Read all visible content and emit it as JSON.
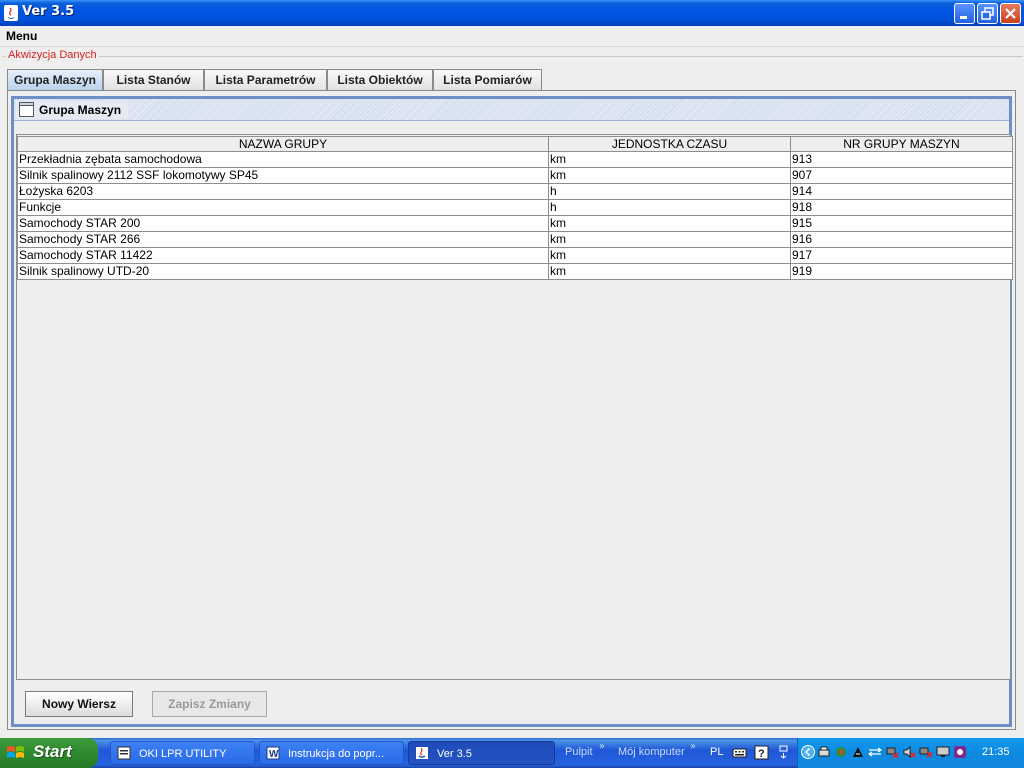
{
  "window": {
    "title": "Ver 3.5"
  },
  "menubar": {
    "menu_label": "Menu"
  },
  "group": {
    "legend": "Akwizycja Danych"
  },
  "tabs": [
    {
      "label": "Grupa Maszyn",
      "active": true
    },
    {
      "label": "Lista Stanów",
      "active": false
    },
    {
      "label": "Lista Parametrów",
      "active": false
    },
    {
      "label": "Lista Obiektów",
      "active": false
    },
    {
      "label": "Lista Pomiarów",
      "active": false
    }
  ],
  "panel": {
    "title": "Grupa Maszyn"
  },
  "table": {
    "columns": [
      "NAZWA GRUPY",
      "JEDNOSTKA CZASU",
      "NR GRUPY MASZYN"
    ],
    "rows": [
      [
        "Przekładnia zębata samochodowa",
        "km",
        "913"
      ],
      [
        "Silnik spalinowy 2112 SSF lokomotywy SP45",
        "km",
        "907"
      ],
      [
        "Łożyska 6203",
        "h",
        "914"
      ],
      [
        "Funkcje",
        "h",
        "918"
      ],
      [
        "Samochody STAR 200",
        "km",
        "915"
      ],
      [
        "Samochody STAR 266",
        "km",
        "916"
      ],
      [
        "Samochody STAR 11422",
        "km",
        "917"
      ],
      [
        "Silnik spalinowy UTD-20",
        "km",
        "919"
      ]
    ]
  },
  "buttons": {
    "new_row": "Nowy Wiersz",
    "save_changes": "Zapisz Zmiany"
  },
  "taskbar": {
    "start_label": "Start",
    "tasks": [
      {
        "label": "OKI LPR UTILITY",
        "icon": "printer-app-icon"
      },
      {
        "label": "Instrukcja do popr...",
        "icon": "word-document-icon"
      },
      {
        "label": "Ver 3.5",
        "icon": "java-app-icon"
      }
    ],
    "quick_links": [
      "Pulpit",
      "Mój komputer"
    ],
    "language": "PL",
    "clock": "21:35"
  },
  "colors": {
    "titlebar": "#0054e3",
    "legend_text": "#d82020",
    "frame_border": "#6d8fc7",
    "taskbar": "#2157d7",
    "start_button": "#2f8b2f"
  }
}
